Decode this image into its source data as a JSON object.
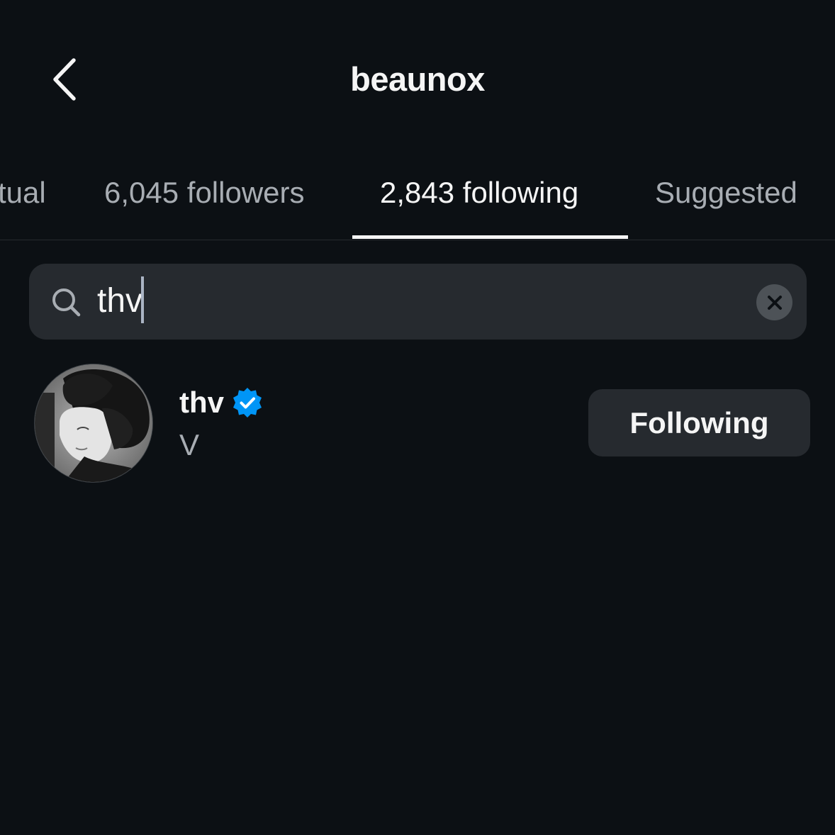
{
  "header": {
    "title": "beaunox",
    "back_icon": "chevron-left-icon"
  },
  "tabs": [
    {
      "label": "Mutual",
      "visible_text": "tual",
      "active": false
    },
    {
      "label": "6,045 followers",
      "active": false
    },
    {
      "label": "2,843 following",
      "active": true
    },
    {
      "label": "Suggested",
      "active": false
    }
  ],
  "search": {
    "value": "thv",
    "search_icon": "search-icon",
    "clear_icon": "close-icon"
  },
  "results": [
    {
      "username": "thv",
      "full_name": "V",
      "verified": true,
      "button_label": "Following"
    }
  ],
  "colors": {
    "background": "#0c1014",
    "surface": "#262a2f",
    "text_primary": "#f5f5f5",
    "text_secondary": "#a8adb3",
    "verified_blue": "#0095f6"
  }
}
